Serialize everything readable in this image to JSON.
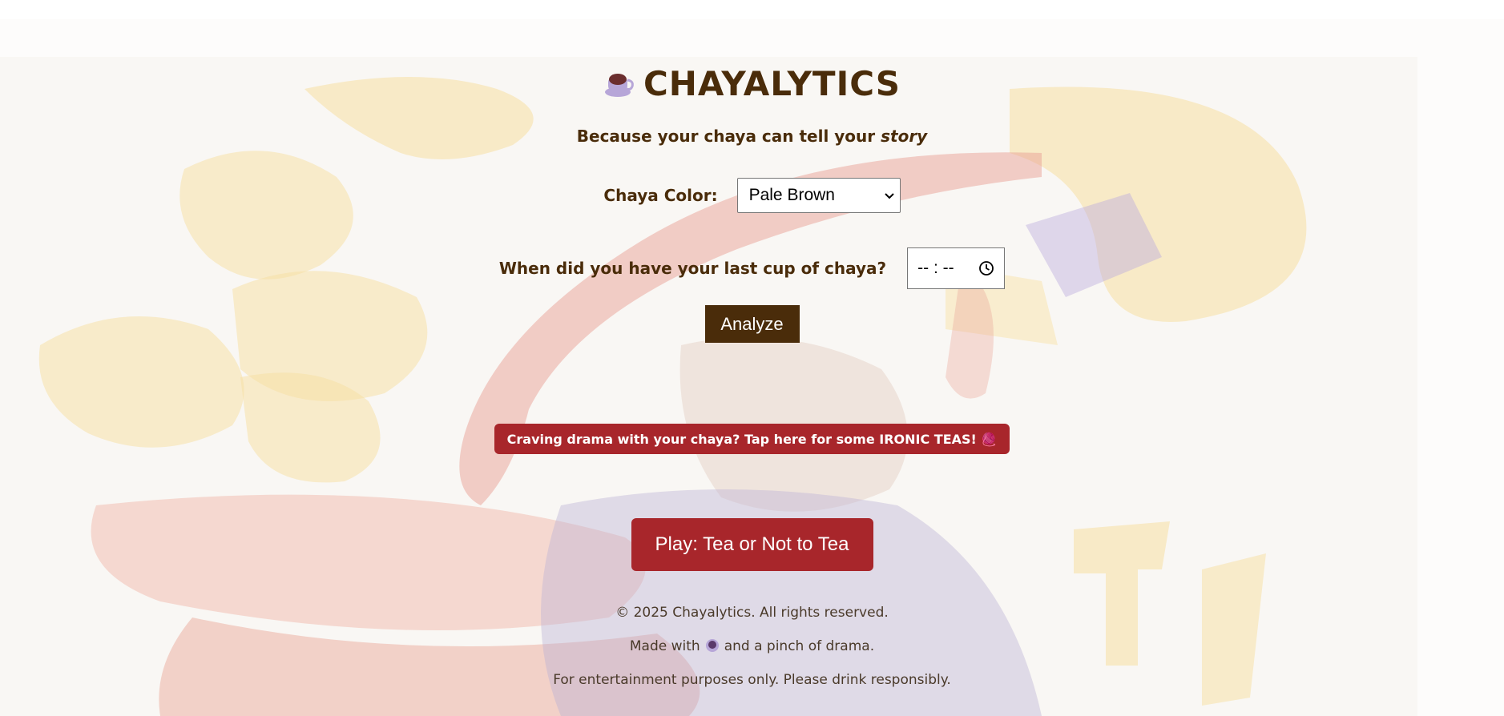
{
  "header": {
    "title": "CHAYALYTICS",
    "tagline_prefix": "Because your chaya can tell your ",
    "tagline_emphasis": "story",
    "logo_icon": "tea-cup-icon"
  },
  "form": {
    "color_label": "Chaya Color:",
    "color_selected": "Pale Brown",
    "time_label": "When did you have your last cup of chaya?",
    "time_value": "-- : --",
    "analyze_label": "Analyze"
  },
  "cta": {
    "ironic_label": "Craving drama with your chaya? Tap here for some IRONIC TEAS! 🧶",
    "play_label": "Play: Tea or Not to Tea"
  },
  "footer": {
    "copyright": "© 2025 Chayalytics. All rights reserved.",
    "made_with_prefix": "Made with",
    "made_with_suffix": "and a pinch of drama.",
    "disclaimer": "For entertainment purposes only. Please drink responsibly."
  },
  "colors": {
    "brand_brown": "#4a2c0a",
    "accent_red": "#a8262b",
    "background": "#fdfcfb"
  }
}
